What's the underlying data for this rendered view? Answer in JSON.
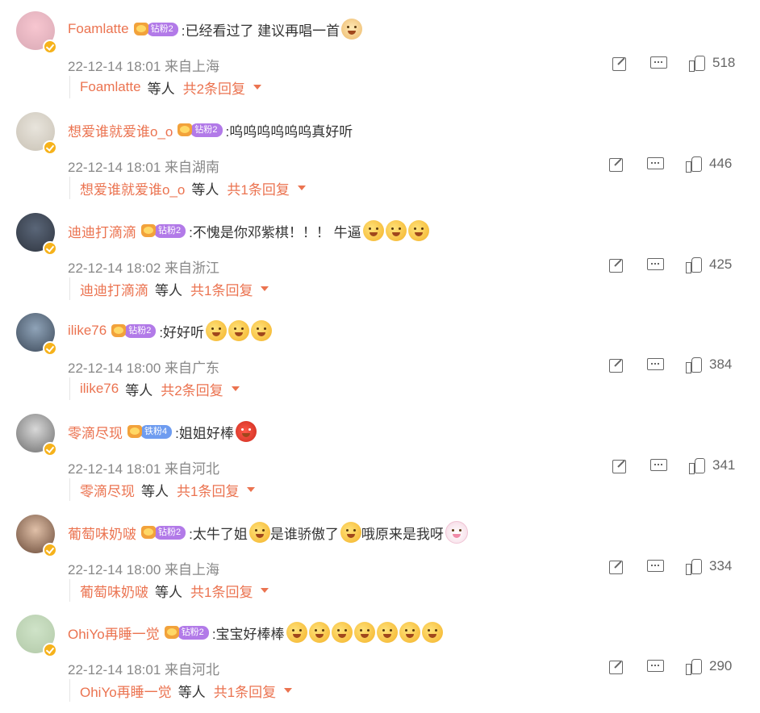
{
  "comments": [
    {
      "name": "Foamlatte",
      "badge": "钻粉2",
      "badge_type": "zuan",
      "text": ":已经看过了 建议再唱一首",
      "emojis": [
        "dog"
      ],
      "time": "22-12-14 18:01 来自上海",
      "likes": "518",
      "reply_name": "Foamlatte",
      "etc": "等人",
      "reply_count": "共2条回复",
      "avatar_colors": [
        "#f7c6d0",
        "#d9a9b5"
      ]
    },
    {
      "name": "想爱谁就爱谁o_o",
      "badge": "钻粉2",
      "badge_type": "zuan",
      "text": ":呜呜呜呜呜呜真好听",
      "emojis": [],
      "time": "22-12-14 18:01 来自湖南",
      "likes": "446",
      "reply_name": "想爱谁就爱谁o_o",
      "etc": "等人",
      "reply_count": "共1条回复",
      "avatar_colors": [
        "#e8e4dc",
        "#c9c2b5"
      ]
    },
    {
      "name": "迪迪打滴滴",
      "badge": "钻粉2",
      "badge_type": "zuan",
      "text": ":不愧是你邓紫棋！！！ 牛逼",
      "emojis": [
        "wow",
        "wow",
        "wow"
      ],
      "time": "22-12-14 18:02 来自浙江",
      "likes": "425",
      "reply_name": "迪迪打滴滴",
      "etc": "等人",
      "reply_count": "共1条回复",
      "avatar_colors": [
        "#5a6678",
        "#2f3540"
      ]
    },
    {
      "name": "ilike76",
      "badge": "钻粉2",
      "badge_type": "zuan",
      "text": ":好好听",
      "emojis": [
        "think",
        "think",
        "think"
      ],
      "time": "22-12-14 18:00 来自广东",
      "likes": "384",
      "reply_name": "ilike76",
      "etc": "等人",
      "reply_count": "共2条回复",
      "avatar_colors": [
        "#8fa3b8",
        "#3d4a5a"
      ]
    },
    {
      "name": "零滴尽现",
      "badge": "铁粉4",
      "badge_type": "tie",
      "text": ":姐姐好棒",
      "emojis": [
        "tomato"
      ],
      "time": "22-12-14 18:01 来自河北",
      "likes": "341",
      "reply_name": "零滴尽现",
      "etc": "等人",
      "reply_count": "共1条回复",
      "avatar_colors": [
        "#d8d8d8",
        "#6e6e6e"
      ]
    },
    {
      "name": "葡萄味奶啵",
      "badge": "钻粉2",
      "badge_type": "zuan",
      "text_parts": [
        ":太牛了姐",
        "是谁骄傲了",
        "哦原来是我呀"
      ],
      "emojis_between": [
        "proud",
        "flower",
        "rabbit"
      ],
      "time": "22-12-14 18:00 来自上海",
      "likes": "334",
      "reply_name": "葡萄味奶啵",
      "etc": "等人",
      "reply_count": "共1条回复",
      "avatar_colors": [
        "#e0c0a8",
        "#6a4a38"
      ]
    },
    {
      "name": "OhiYo再睡一觉",
      "badge": "钻粉2",
      "badge_type": "zuan",
      "text": ":宝宝好棒棒",
      "emojis": [
        "love",
        "love",
        "love",
        "love",
        "love",
        "love",
        "love"
      ],
      "time": "22-12-14 18:01 来自河北",
      "likes": "290",
      "reply_name": "OhiYo再睡一觉",
      "etc": "等人",
      "reply_count": "共1条回复",
      "avatar_colors": [
        "#cfe3c8",
        "#b2c9a8"
      ]
    }
  ],
  "icons": {
    "share": "share-icon",
    "comment": "comment-icon",
    "like": "like-icon",
    "verified": "verified-icon",
    "caret": "caret-down-icon"
  },
  "colors": {
    "accent": "#eb7350",
    "text": "#333333",
    "meta": "#888888"
  }
}
